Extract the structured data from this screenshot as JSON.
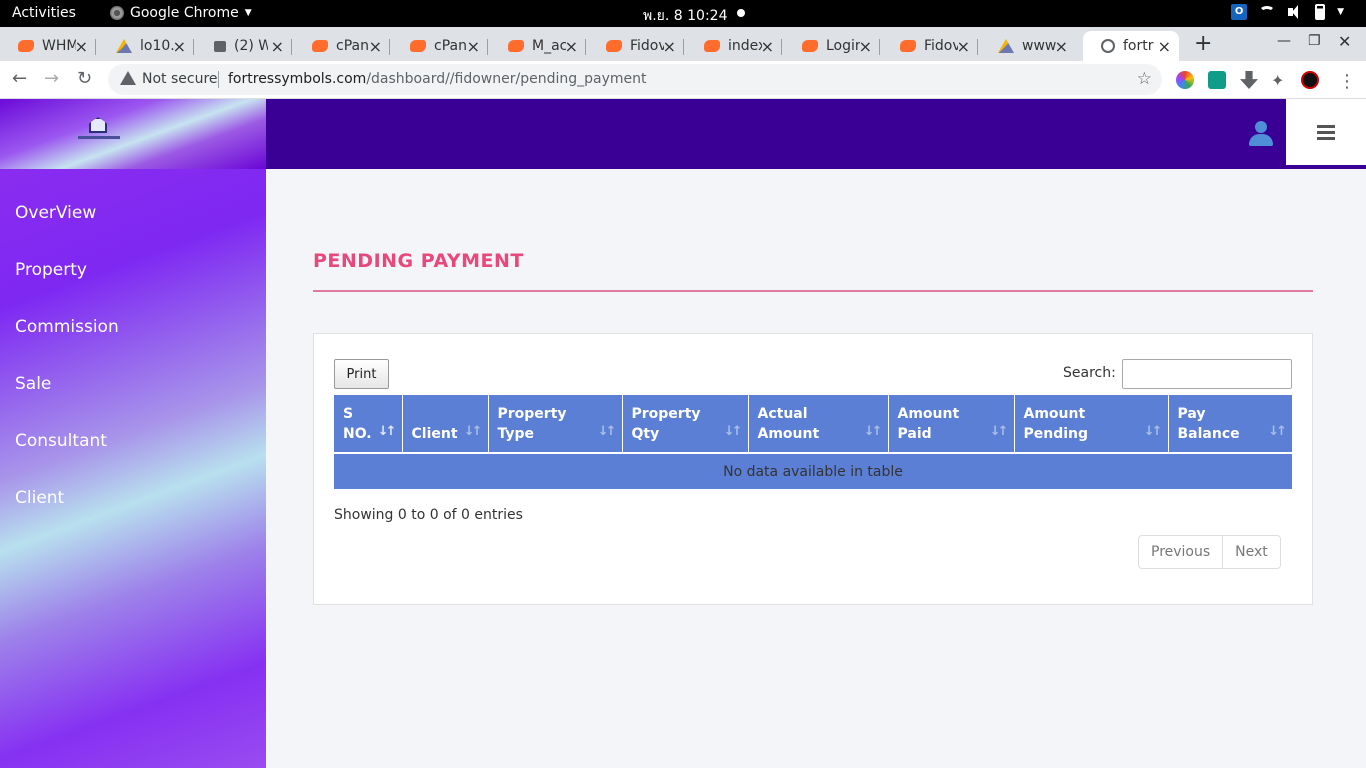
{
  "system": {
    "activities": "Activities",
    "app_name": "Google Chrome",
    "clock": "พ.ย. 8  10:24"
  },
  "tabs": [
    {
      "label": "WHM",
      "icon": "cpanel-icon"
    },
    {
      "label": "lo10.",
      "icon": "phpmyadmin-icon"
    },
    {
      "label": "(2) W",
      "icon": "messages-icon"
    },
    {
      "label": "cPan",
      "icon": "cpanel-icon"
    },
    {
      "label": "cPan",
      "icon": "cpanel-icon"
    },
    {
      "label": "M_ac",
      "icon": "cpanel-icon"
    },
    {
      "label": "Fidov",
      "icon": "cpanel-icon"
    },
    {
      "label": "index",
      "icon": "cpanel-icon"
    },
    {
      "label": "Login",
      "icon": "cpanel-icon"
    },
    {
      "label": "Fidov",
      "icon": "cpanel-icon"
    },
    {
      "label": "www",
      "icon": "phpmyadmin-icon"
    },
    {
      "label": "fortr",
      "icon": "globe-icon",
      "active": true
    }
  ],
  "address_bar": {
    "security": "Not secure",
    "domain": "fortressymbols.com",
    "path": "/dashboard//fidowner/pending_payment"
  },
  "sidebar": {
    "items": [
      {
        "label": "OverView"
      },
      {
        "label": "Property"
      },
      {
        "label": "Commission"
      },
      {
        "label": "Sale"
      },
      {
        "label": "Consultant"
      },
      {
        "label": "Client"
      }
    ]
  },
  "page": {
    "title": "PENDING PAYMENT"
  },
  "table": {
    "print_label": "Print",
    "search_label": "Search:",
    "search_value": "",
    "columns": [
      {
        "line1": "S",
        "line2": "NO."
      },
      {
        "line1": "",
        "line2": "Client"
      },
      {
        "line1": "Property",
        "line2": "Type"
      },
      {
        "line1": "Property",
        "line2": "Qty"
      },
      {
        "line1": "Actual",
        "line2": "Amount"
      },
      {
        "line1": "Amount",
        "line2": "Paid"
      },
      {
        "line1": "Amount",
        "line2": "Pending"
      },
      {
        "line1": "Pay",
        "line2": "Balance"
      }
    ],
    "rows": [],
    "empty_message": "No data available in table",
    "info": "Showing 0 to 0 of 0 entries",
    "prev_label": "Previous",
    "next_label": "Next"
  },
  "colors": {
    "header_bg": "#3a0096",
    "title_accent": "#e8487a",
    "table_header": "#5b7fd4"
  }
}
